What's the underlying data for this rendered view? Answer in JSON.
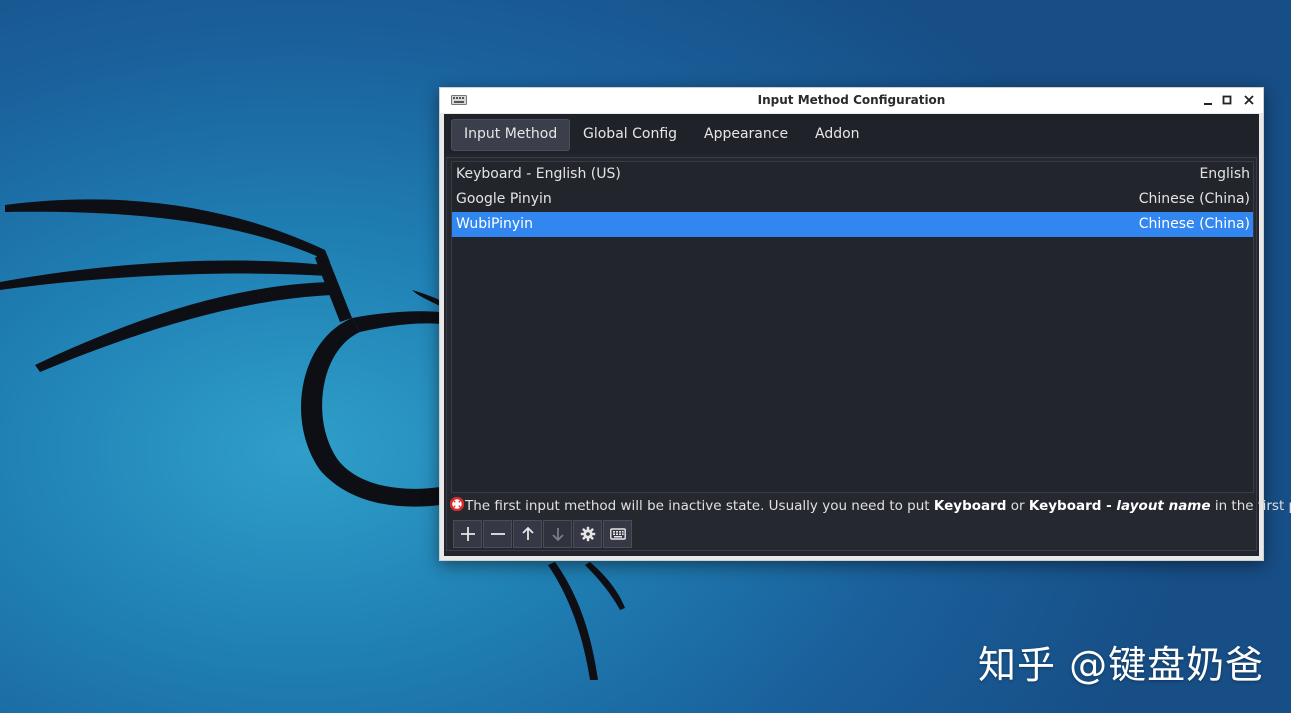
{
  "desktop": {
    "watermark": "知乎 @键盘奶爸",
    "background_color": "#1f7fb3"
  },
  "window": {
    "title": "Input Method Configuration",
    "icon": "keyboard-icon",
    "controls": {
      "minimize": "minimize-icon",
      "maximize": "maximize-icon",
      "close": "close-icon"
    }
  },
  "tabs": [
    {
      "label": "Input Method",
      "active": true
    },
    {
      "label": "Global Config",
      "active": false
    },
    {
      "label": "Appearance",
      "active": false
    },
    {
      "label": "Addon",
      "active": false
    }
  ],
  "input_methods": [
    {
      "name": "Keyboard - English (US)",
      "language": "English",
      "selected": false
    },
    {
      "name": "Google Pinyin",
      "language": "Chinese (China)",
      "selected": false
    },
    {
      "name": "WubiPinyin",
      "language": "Chinese (China)",
      "selected": true
    }
  ],
  "notice": {
    "icon": "warning-icon",
    "text_1": "The first input method will be inactive state. Usually you need to put ",
    "bold_1": "Keyboard",
    "text_2": " or ",
    "bold_2": "Keyboard - ",
    "italic": "layout name",
    "text_3": " in the first place."
  },
  "toolbar": {
    "buttons": [
      {
        "icon": "plus-icon",
        "enabled": true
      },
      {
        "icon": "minus-icon",
        "enabled": true
      },
      {
        "icon": "arrow-up-icon",
        "enabled": true
      },
      {
        "icon": "arrow-down-icon",
        "enabled": false
      },
      {
        "icon": "gear-icon",
        "enabled": true
      },
      {
        "icon": "keyboard-icon",
        "enabled": true
      }
    ]
  },
  "colors": {
    "selection": "#3286f0",
    "panel": "#23252e",
    "titlebar": "#ffffff"
  }
}
